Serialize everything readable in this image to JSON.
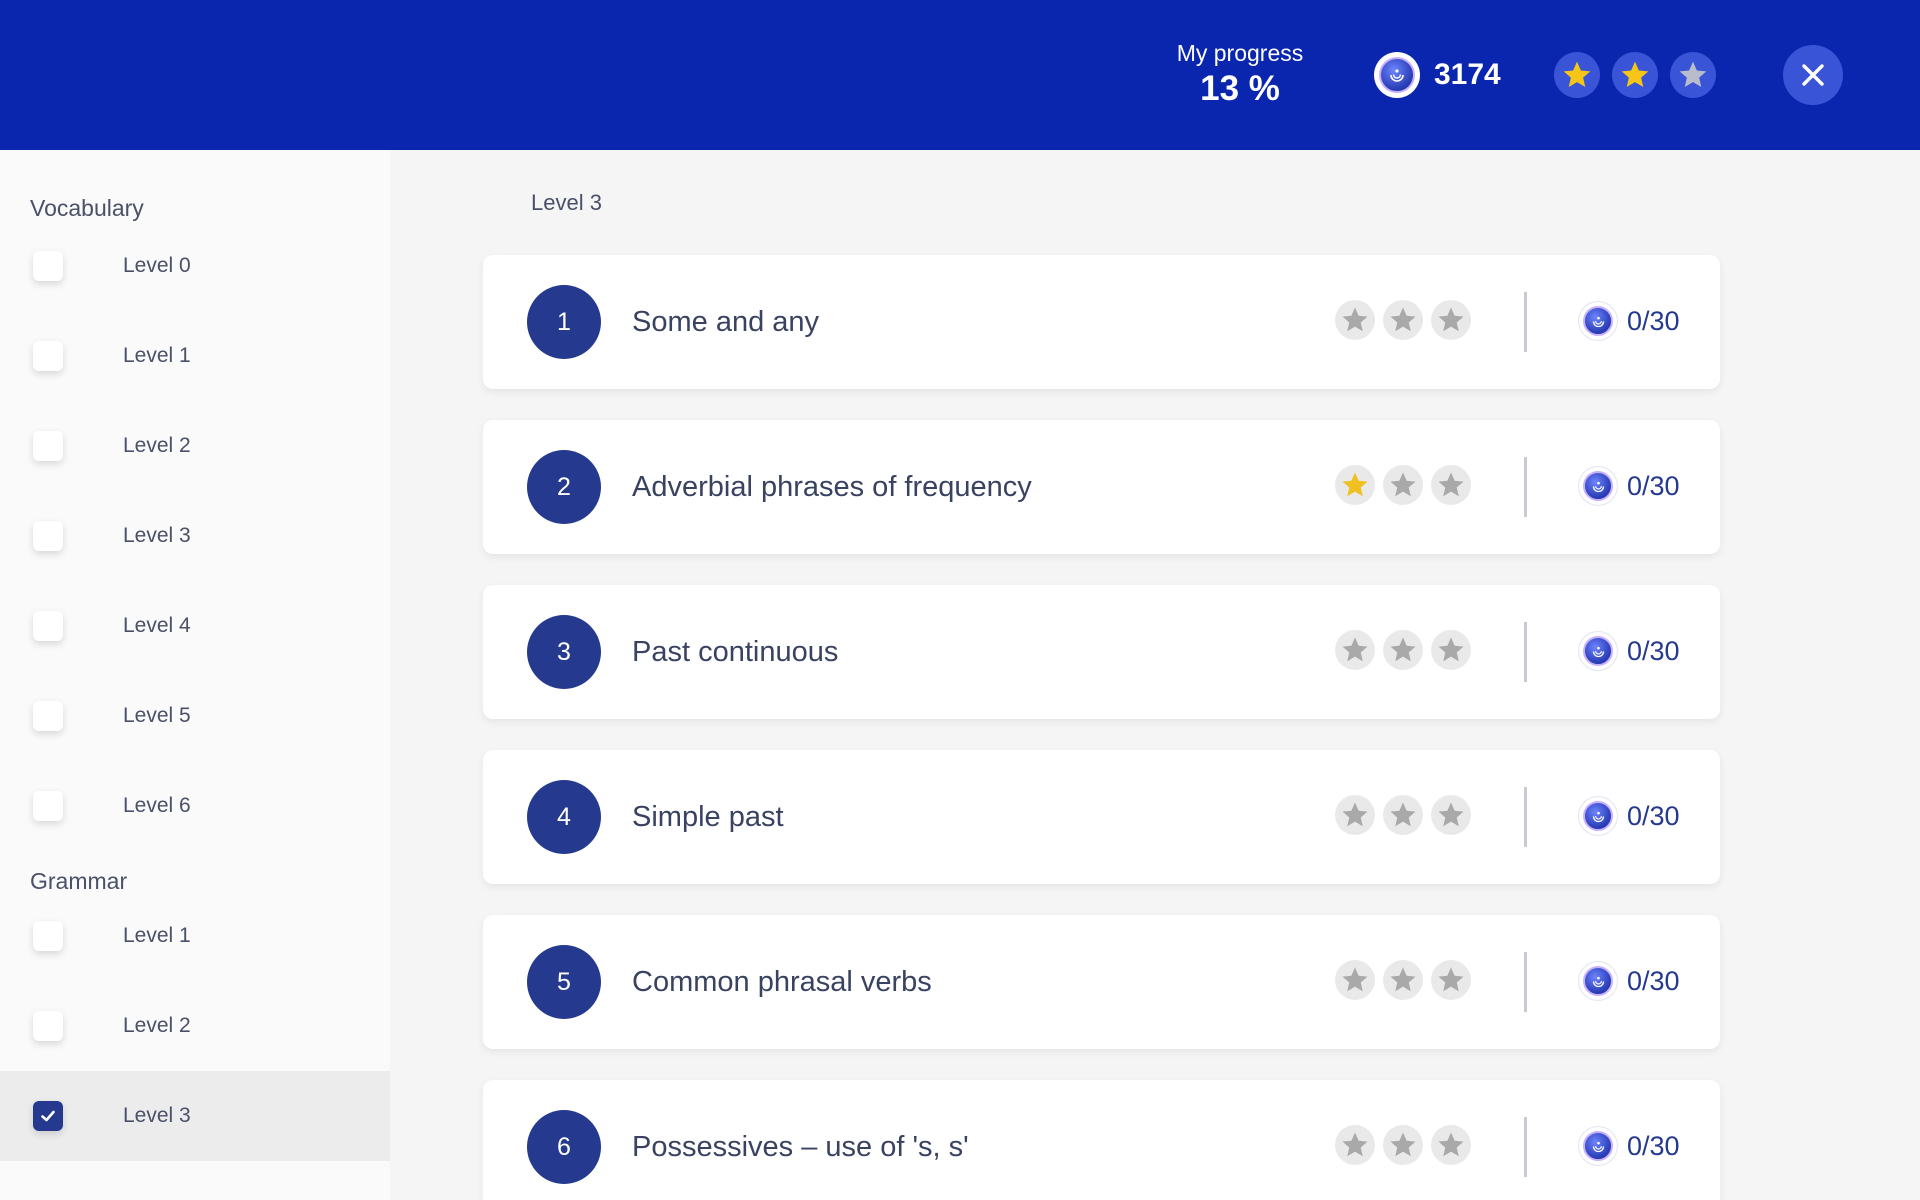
{
  "header": {
    "progress_label": "My progress",
    "progress_value": "13 %",
    "coins": "3174",
    "stars_earned": 2,
    "stars_total": 3,
    "colors": {
      "bg": "#0a26ae",
      "accent": "#3a54d8",
      "star_gold": "#f5c518"
    }
  },
  "sidebar": {
    "sections": [
      {
        "heading": "Vocabulary",
        "levels": [
          {
            "label": "Level 0",
            "checked": false
          },
          {
            "label": "Level 1",
            "checked": false
          },
          {
            "label": "Level 2",
            "checked": false
          },
          {
            "label": "Level 3",
            "checked": false
          },
          {
            "label": "Level 4",
            "checked": false
          },
          {
            "label": "Level 5",
            "checked": false
          },
          {
            "label": "Level 6",
            "checked": false
          }
        ]
      },
      {
        "heading": "Grammar",
        "levels": [
          {
            "label": "Level 1",
            "checked": false
          },
          {
            "label": "Level 2",
            "checked": false
          },
          {
            "label": "Level 3",
            "checked": true
          }
        ]
      }
    ]
  },
  "main": {
    "title": "Level 3",
    "lessons": [
      {
        "number": "1",
        "title": "Some and any",
        "stars": 0,
        "score": "0/30"
      },
      {
        "number": "2",
        "title": "Adverbial phrases of frequency",
        "stars": 1,
        "score": "0/30"
      },
      {
        "number": "3",
        "title": "Past continuous",
        "stars": 0,
        "score": "0/30"
      },
      {
        "number": "4",
        "title": "Simple past",
        "stars": 0,
        "score": "0/30"
      },
      {
        "number": "5",
        "title": "Common phrasal verbs",
        "stars": 0,
        "score": "0/30"
      },
      {
        "number": "6",
        "title": "Possessives – use of 's, s'",
        "stars": 0,
        "score": "0/30"
      }
    ]
  },
  "icons": {
    "close": "close-icon",
    "coin": "coin-icon",
    "star": "star-icon",
    "check": "check-icon"
  }
}
